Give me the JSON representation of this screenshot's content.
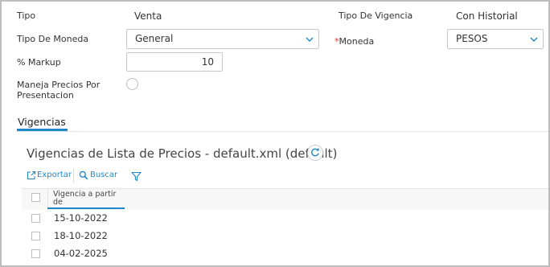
{
  "form": {
    "tipo_label": "Tipo",
    "tipo_value": "Venta",
    "tipo_vigencia_label": "Tipo De Vigencia",
    "tipo_vigencia_value": "Con Historial",
    "tipo_moneda_label": "Tipo De Moneda",
    "tipo_moneda_value": "General",
    "moneda_required": "*",
    "moneda_label": "Moneda",
    "moneda_value": "PESOS",
    "markup_label": "% Markup",
    "markup_value": "10",
    "maneja_precios_label_1": "Maneja Precios Por",
    "maneja_precios_label_2": "Presentacion"
  },
  "tabs": [
    {
      "label": "Vigencias",
      "active": true
    }
  ],
  "section": {
    "title": "Vigencias de Lista de Precios - default.xml (default)"
  },
  "toolbar": {
    "export_label": "Exportar",
    "search_label": "Buscar"
  },
  "table": {
    "header_line_1": "Vigencia a partir",
    "header_line_2": "de",
    "rows": [
      "15-10-2022",
      "18-10-2022",
      "04-02-2025"
    ]
  },
  "colors": {
    "accent": "#1e88c8",
    "required": "#e53935"
  }
}
